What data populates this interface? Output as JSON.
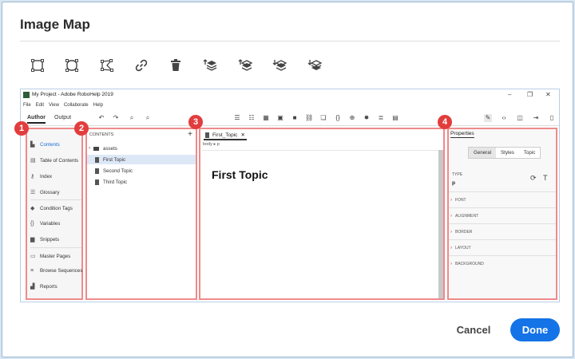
{
  "dialog": {
    "title": "Image Map",
    "cancel_label": "Cancel",
    "done_label": "Done",
    "accent": "#1473e6"
  },
  "toolbar": {
    "tools": [
      "rectangle-icon",
      "circle-icon",
      "polygon-icon",
      "link-icon",
      "delete-icon",
      "bring-to-front-icon",
      "bring-forward-icon",
      "send-backward-icon",
      "send-to-back-icon"
    ]
  },
  "screenshot": {
    "window_title": "My Project - Adobe RoboHelp 2019",
    "menus": [
      "File",
      "Edit",
      "View",
      "Collaborate",
      "Help"
    ],
    "mode_tabs": [
      "Author",
      "Output"
    ],
    "win_controls": [
      "–",
      "❐",
      "✕"
    ],
    "badges": [
      "1",
      "2",
      "3",
      "4"
    ],
    "left_nav": [
      {
        "label": "Contents",
        "icon": "folder-icon",
        "selected": true
      },
      {
        "label": "Table of Contents",
        "icon": "toc-icon"
      },
      {
        "label": "Index",
        "icon": "key-icon"
      },
      {
        "label": "Glossary",
        "icon": "list-icon"
      },
      {
        "label": "Condition Tags",
        "icon": "tag-icon"
      },
      {
        "label": "Variables",
        "icon": "braces-icon"
      },
      {
        "label": "Snippets",
        "icon": "snippet-icon"
      },
      {
        "label": "Master Pages",
        "icon": "page-icon"
      },
      {
        "label": "Browse Sequences",
        "icon": "sequence-icon"
      },
      {
        "label": "Reports",
        "icon": "report-icon"
      }
    ],
    "contents_panel": {
      "header": "CONTENTS",
      "add": "+",
      "items": [
        {
          "label": "assets",
          "type": "folder"
        },
        {
          "label": "First Topic",
          "type": "topic",
          "selected": true
        },
        {
          "label": "Second Topic",
          "type": "topic"
        },
        {
          "label": "Third Topic",
          "type": "topic"
        }
      ]
    },
    "editor": {
      "tab_label": "First_Topic",
      "tab_close": "✕",
      "breadcrumb": "body ▸ p",
      "heading": "First Topic"
    },
    "properties": {
      "title": "Properties",
      "tabs": [
        "General",
        "Styles",
        "Topic"
      ],
      "type_label": "TYPE",
      "type_value": "p",
      "sections": [
        "FONT",
        "ALIGNMENT",
        "BORDER",
        "LAYOUT",
        "BACKGROUND"
      ]
    }
  }
}
